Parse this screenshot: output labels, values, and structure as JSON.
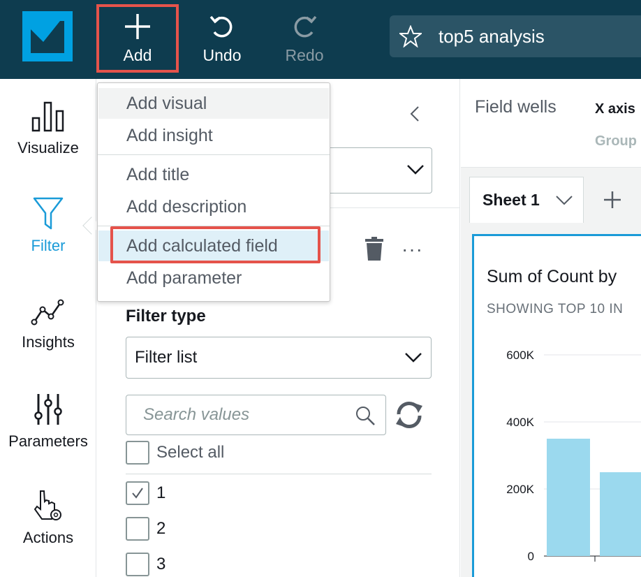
{
  "toolbar": {
    "add_label": "Add",
    "undo_label": "Undo",
    "redo_label": "Redo",
    "analysis_title": "top5 analysis"
  },
  "rail": {
    "items": [
      {
        "label": "Visualize",
        "icon": "bar-chart-icon"
      },
      {
        "label": "Filter",
        "icon": "filter-icon",
        "active": true
      },
      {
        "label": "Insights",
        "icon": "insights-icon"
      },
      {
        "label": "Parameters",
        "icon": "sliders-icon"
      },
      {
        "label": "Actions",
        "icon": "pointer-gear-icon"
      }
    ]
  },
  "add_menu": {
    "items": [
      "Add visual",
      "Add insight",
      "Add title",
      "Add description",
      "Add calculated field",
      "Add parameter"
    ],
    "highlighted": "Add calculated field"
  },
  "filter_panel": {
    "more_label": "···",
    "filter_type_label": "Filter type",
    "filter_type_value": "Filter list",
    "search_placeholder": "Search values",
    "select_all_label": "Select all",
    "values": [
      {
        "label": "1",
        "checked": true
      },
      {
        "label": "2",
        "checked": false
      },
      {
        "label": "3",
        "checked": false
      }
    ]
  },
  "canvas": {
    "field_wells_label": "Field wells",
    "x_axis_label": "X axis",
    "group_label": "Group",
    "sheet_tab_label": "Sheet 1",
    "visual_title": "Sum of Count by",
    "visual_subtitle": "SHOWING TOP 10 IN"
  },
  "chart_data": {
    "type": "bar",
    "y_ticks": [
      "600K",
      "400K",
      "200K",
      "0"
    ],
    "ylim": [
      0,
      600000
    ],
    "values": [
      350000,
      250000
    ],
    "color": "#9bd9ee"
  },
  "colors": {
    "topbar": "#0e3c4f",
    "accent": "#1a9bd8",
    "highlight_border": "#e5534b"
  }
}
